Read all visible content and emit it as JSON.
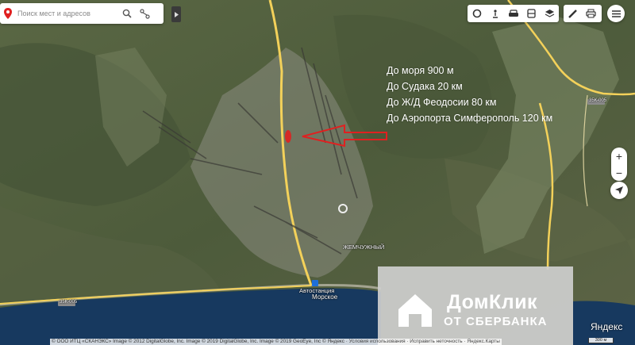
{
  "search": {
    "placeholder": "Поиск мест и адресов"
  },
  "info": {
    "lines": [
      "До моря 900 м",
      "До Судака 20 км",
      "До Ж/Д Феодосии 80 км",
      "До Аэропорта Симферополь 120 км"
    ]
  },
  "labels": {
    "pearl": "ЖЕМЧУЖНЫЙ",
    "bus_station": "Автостанция",
    "morskoe": "Морское",
    "road_left": "35К-005",
    "road_right": "35К-005"
  },
  "watermark": {
    "line1": "ДомКлик",
    "line2": "ОТ СБЕРБАНКА"
  },
  "yandex_logo": "Яндекс",
  "scale_label": "300 м",
  "copyright": {
    "text": "© ООО ИТЦ «СКАНЭКС» Image © 2012 DigitalGlobe, Inc. Image © 2019 DigitalGlobe, Inc. Image © 2019 GeoEye, Inc © Яндекс",
    "terms": "Условия использования",
    "fix": "Исправить неточность",
    "link": "Яндекс.Карты"
  },
  "icons": {
    "pin": "map-pin-icon",
    "search": "search-icon",
    "route": "route-icon",
    "traffic": "traffic-icon",
    "panorama": "panorama-icon",
    "transport": "transport-icon",
    "layers": "layers-icon",
    "ruler": "ruler-icon",
    "print": "print-icon",
    "menu": "menu-icon",
    "location": "location-icon"
  },
  "colors": {
    "sea": "#17395f",
    "arrow": "#e02020",
    "pin": "#e02020"
  }
}
